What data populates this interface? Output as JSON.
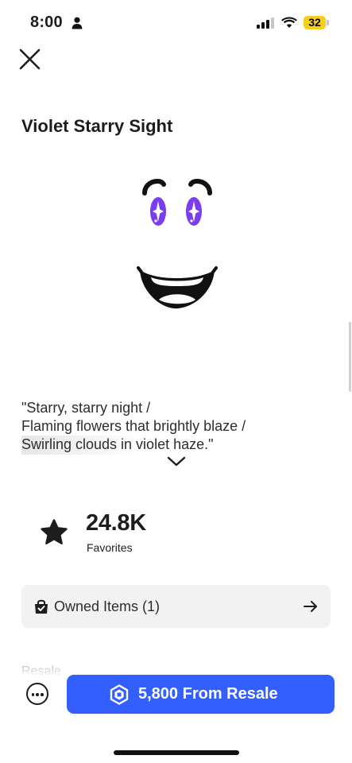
{
  "status_bar": {
    "time": "8:00",
    "battery": "32",
    "icons": [
      "person-icon",
      "signal-icon",
      "wifi-icon",
      "battery-icon"
    ]
  },
  "header": {
    "close_icon": "close-icon"
  },
  "item": {
    "title": "Violet Starry Sight",
    "description_lines": [
      "\"Starry, starry night /",
      "Flaming flowers that brightly blaze /",
      "Swirling clouds in violet haze.\""
    ],
    "expand_icon": "chevron-down-icon"
  },
  "favorites": {
    "count": "24.8K",
    "label": "Favorites",
    "icon": "star-icon"
  },
  "owned": {
    "label": "Owned Items (1)",
    "icon": "shopping-bag-check-icon",
    "arrow_icon": "arrow-right-icon"
  },
  "resale_section_peek": "Resale",
  "bottom_bar": {
    "more_icon": "more-options-icon",
    "buy_label": "5,800 From Resale",
    "currency_icon": "robux-icon"
  },
  "colors": {
    "accent": "#335fff",
    "eye_violet": "#7a3df0",
    "battery": "#f6cf1c",
    "card_bg": "#f2f2f3"
  }
}
